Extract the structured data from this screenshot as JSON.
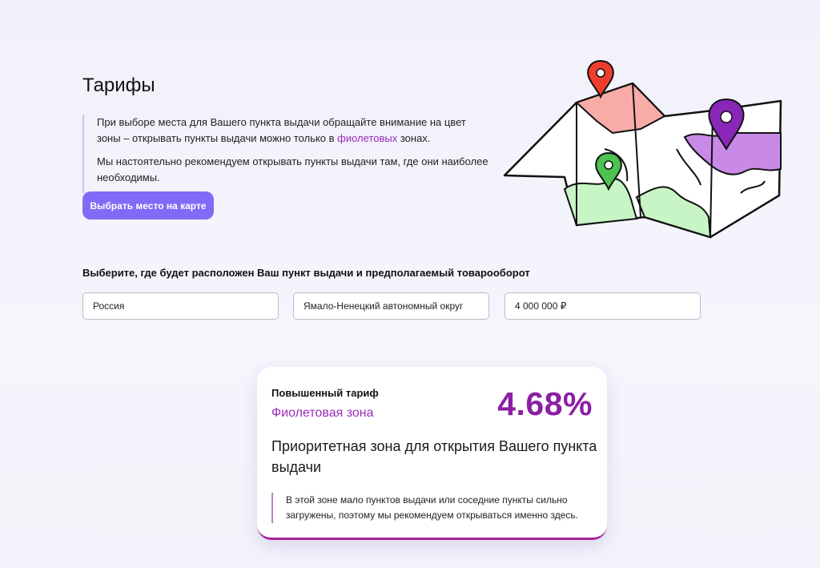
{
  "page": {
    "title": "Тарифы",
    "notice": {
      "p1_before": "При выборе места для Вашего пункта выдачи обращайте внимание на цвет зоны – открывать пункты выдачи можно только в ",
      "p1_accent": "фиолетовых",
      "p1_after": " зонах.",
      "p2": "Мы настоятельно рекомендуем открывать пункты выдачи там, где они наиболее необходимы."
    },
    "map_button": "Выбрать место на карте"
  },
  "selection": {
    "label": "Выберите, где будет расположен Ваш пункт выдачи и предполагаемый товарооборот",
    "country": "Россия",
    "region": "Ямало-Ненецкий автономный округ",
    "turnover": "4 000 000 ₽"
  },
  "tariff_card": {
    "name": "Повышенный тариф",
    "zone": "Фиолетовая зона",
    "rate": "4.68%",
    "headline": "Приоритетная зона для открытия Вашего пункта выдачи",
    "description": "В этой зоне мало пунктов выдачи или соседние пункты сильно загружены, поэтому мы рекомендуем открываться именно здесь."
  },
  "colors": {
    "accent_button": "#7f6bf5",
    "purple_zone": "#9a2db6",
    "rate": "#8b1fa3",
    "map_red": "#f8aca7",
    "map_green": "#c8f5c6",
    "map_purple": "#c88ae6"
  },
  "icons": {
    "map_illustration": "folded-map-with-pins",
    "pins": [
      "red-pin-icon",
      "green-pin-icon",
      "purple-pin-icon"
    ]
  }
}
